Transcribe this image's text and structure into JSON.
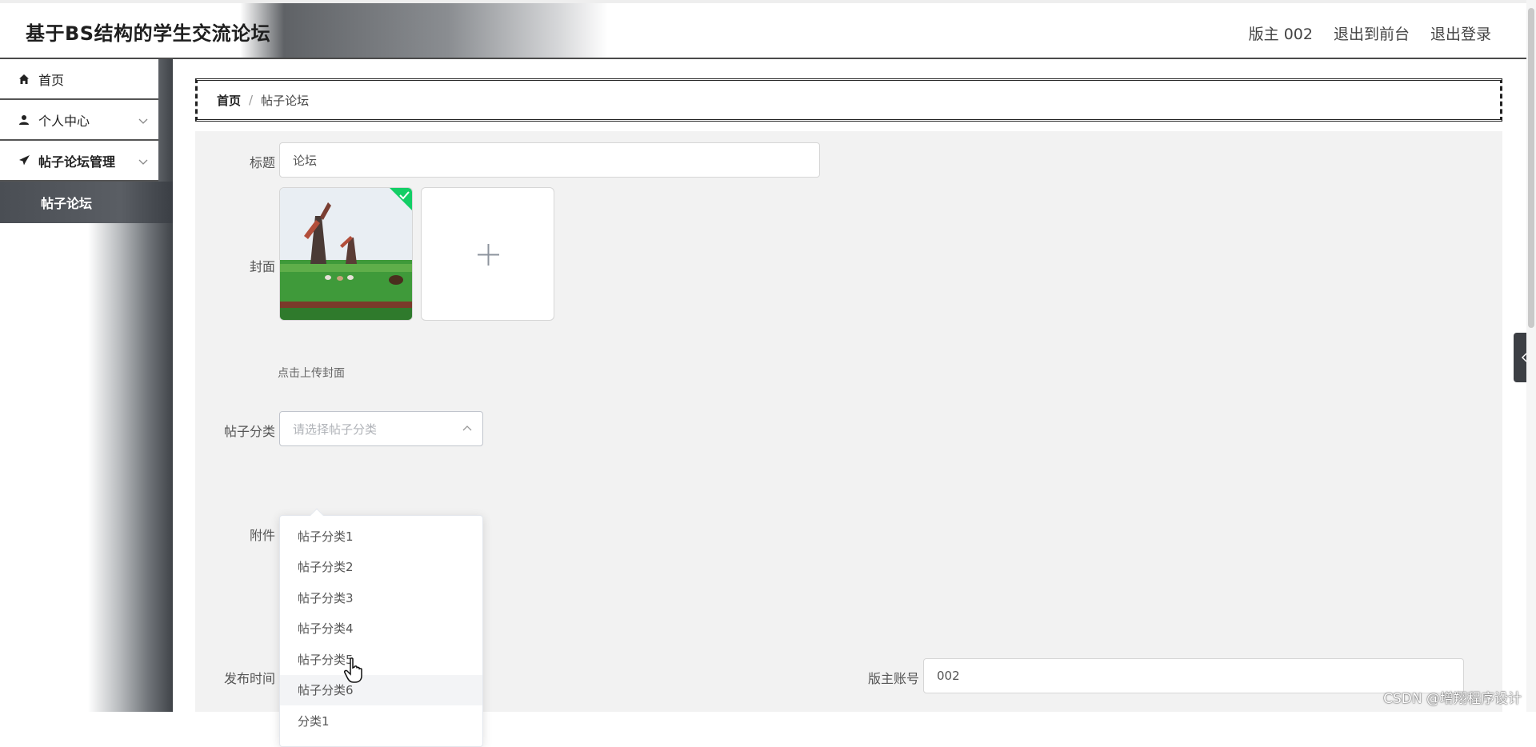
{
  "app": {
    "title": "基于BS结构的学生交流论坛"
  },
  "header": {
    "links": [
      "版主 002",
      "退出到前台",
      "退出登录"
    ]
  },
  "sidebar": {
    "items": [
      {
        "label": "首页",
        "icon": "home-icon"
      },
      {
        "label": "个人中心",
        "icon": "user-icon"
      },
      {
        "label": "帖子论坛管理",
        "icon": "send-icon"
      }
    ],
    "submenu": {
      "label": "帖子论坛"
    }
  },
  "breadcrumb": {
    "home": "首页",
    "separator": "/",
    "current": "帖子论坛"
  },
  "form": {
    "title_label": "标题",
    "title_value": "论坛",
    "cover_label": "封面",
    "cover_hint": "点击上传封面",
    "category_label": "帖子分类",
    "category_placeholder": "请选择帖子分类",
    "attachment_label": "附件",
    "publish_time_label": "发布时间",
    "moderator_label": "版主账号",
    "moderator_value": "002"
  },
  "dropdown": {
    "options": [
      "帖子分类1",
      "帖子分类2",
      "帖子分类3",
      "帖子分类4",
      "帖子分类5",
      "帖子分类6",
      "分类1"
    ],
    "hovered_index": 5
  },
  "watermark": "CSDN @增翔程序设计",
  "colors": {
    "upload_success": "#13ce66",
    "submenu_bg": "#4a4e54",
    "form_bg": "#f2f2f2"
  }
}
